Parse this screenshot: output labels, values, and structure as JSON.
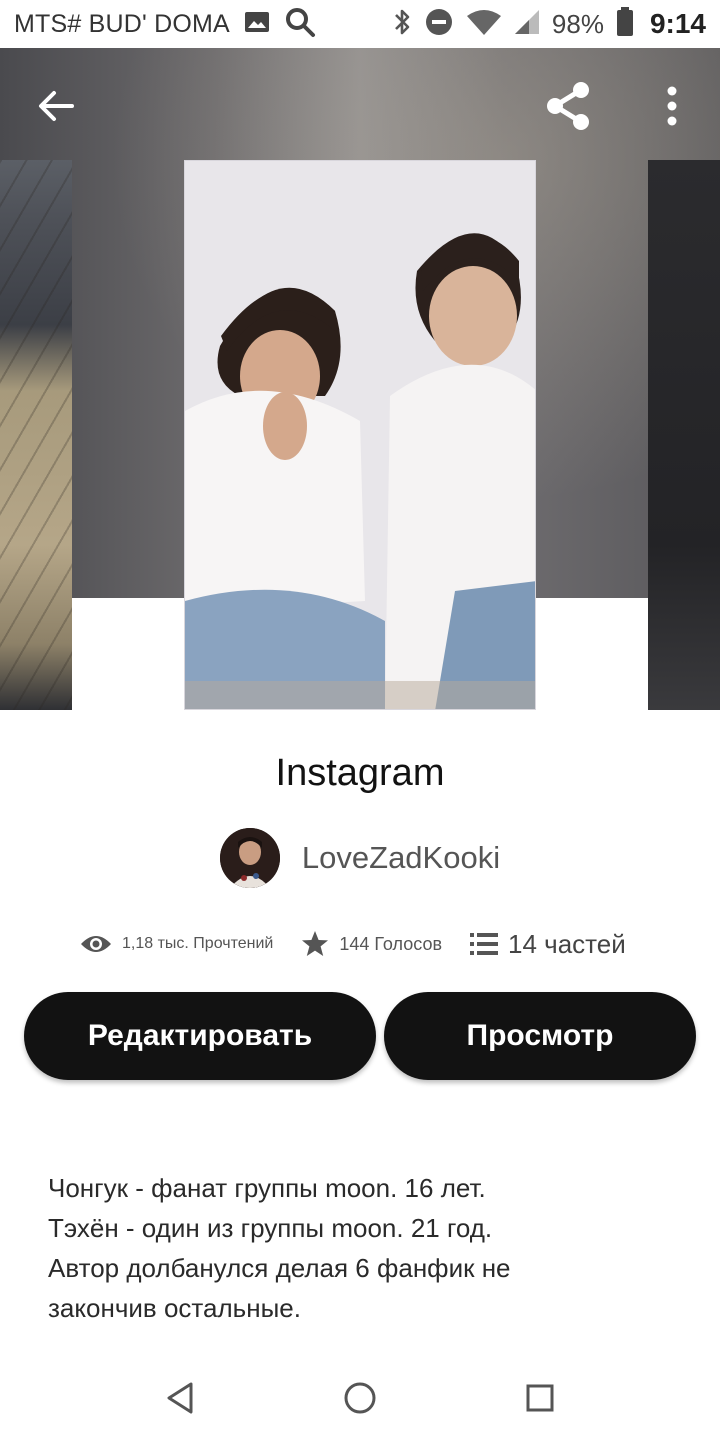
{
  "status_bar": {
    "carrier": "MTS# BUD' DOMA",
    "battery": "98%",
    "time": "9:14",
    "icons": [
      "image-icon",
      "search-icon",
      "bluetooth-icon",
      "do-not-disturb-icon",
      "wifi-icon",
      "signal-icon",
      "battery-icon"
    ]
  },
  "header": {
    "icons": [
      "back-arrow-icon",
      "share-icon",
      "more-vertical-icon"
    ]
  },
  "story": {
    "title": "Instagram",
    "author": "LoveZadKooki",
    "stats": {
      "reads": "1,18 тыс. Прочтений",
      "votes": "144 Голосов",
      "parts": "14 частей"
    },
    "actions": {
      "edit": "Редактировать",
      "view": "Просмотр"
    },
    "description": "Чонгук - фанат группы moon. 16 лет.\nТэхён - один из группы moon. 21 год.\nАвтор долбанулся делая 6 фанфик не\nзакончив остальные."
  },
  "navigation": {
    "icons": [
      "back-triangle-icon",
      "home-circle-icon",
      "recents-square-icon"
    ]
  },
  "colors": {
    "button_bg": "#121212",
    "button_text": "#ffffff",
    "text_primary": "#121212",
    "text_secondary": "#555555"
  }
}
